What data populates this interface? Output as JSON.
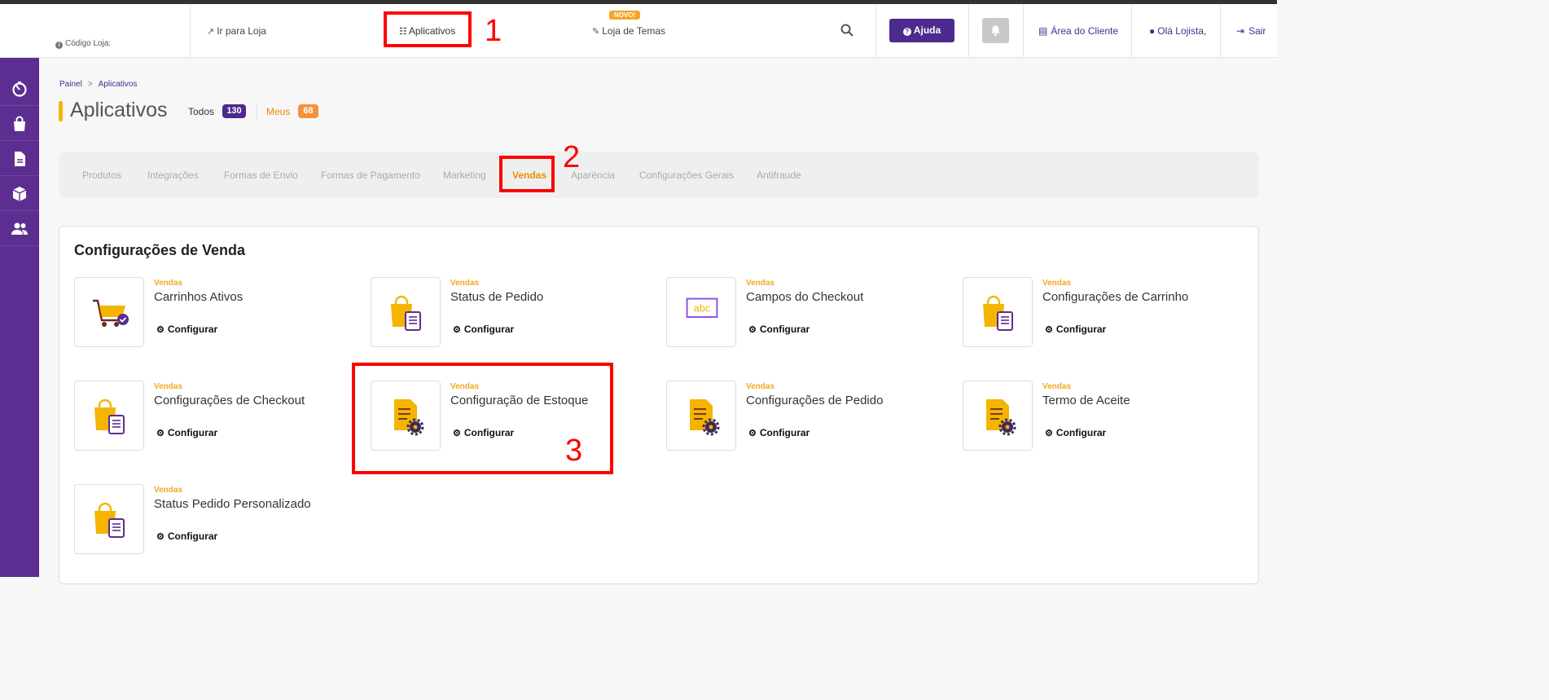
{
  "header": {
    "store_code_label": "Código Loja:",
    "go_to_store": "Ir para Loja",
    "apps": "Aplicativos",
    "novo_badge": "NOVO!",
    "theme_store": "Loja de Temas",
    "help": "Ajuda",
    "client_area": "Área do Cliente",
    "greeting": "Olá Lojista,",
    "logout": "Sair"
  },
  "annotations": [
    "1",
    "2",
    "3"
  ],
  "breadcrumb": {
    "home": "Painel",
    "sep": ">",
    "current": "Aplicativos"
  },
  "page": {
    "title": "Aplicativos",
    "all_label": "Todos",
    "all_count": "130",
    "mine_label": "Meus",
    "mine_count": "68"
  },
  "tabs": [
    "Produtos",
    "Integrações",
    "Formas de Envio",
    "Formas de Pagamento",
    "Marketing",
    "Vendas",
    "Aparência",
    "Configurações Gerais",
    "Antifraude"
  ],
  "active_tab": "Vendas",
  "section": {
    "title": "Configurações de Venda"
  },
  "cards": [
    {
      "category": "Vendas",
      "title": "Carrinhos Ativos",
      "action": "Configurar",
      "icon": "cart-icon"
    },
    {
      "category": "Vendas",
      "title": "Status de Pedido",
      "action": "Configurar",
      "icon": "bag-doc-icon"
    },
    {
      "category": "Vendas",
      "title": "Campos do Checkout",
      "action": "Configurar",
      "icon": "abc-icon"
    },
    {
      "category": "Vendas",
      "title": "Configurações de Carrinho",
      "action": "Configurar",
      "icon": "bag-doc-icon"
    },
    {
      "category": "Vendas",
      "title": "Configurações de Checkout",
      "action": "Configurar",
      "icon": "bag-doc-icon"
    },
    {
      "category": "Vendas",
      "title": "Configuração de Estoque",
      "action": "Configurar",
      "icon": "doc-gear-icon"
    },
    {
      "category": "Vendas",
      "title": "Configurações de Pedido",
      "action": "Configurar",
      "icon": "doc-gear-icon"
    },
    {
      "category": "Vendas",
      "title": "Termo de Aceite",
      "action": "Configurar",
      "icon": "doc-gear-icon"
    },
    {
      "category": "Vendas",
      "title": "Status Pedido Personalizado",
      "action": "Configurar",
      "icon": "bag-doc-icon"
    }
  ],
  "abc_text": "abc",
  "colors": {
    "purple": "#5c2e91",
    "orange": "#f08a00",
    "yellow": "#f5b400",
    "highlight": "#ff0000"
  }
}
